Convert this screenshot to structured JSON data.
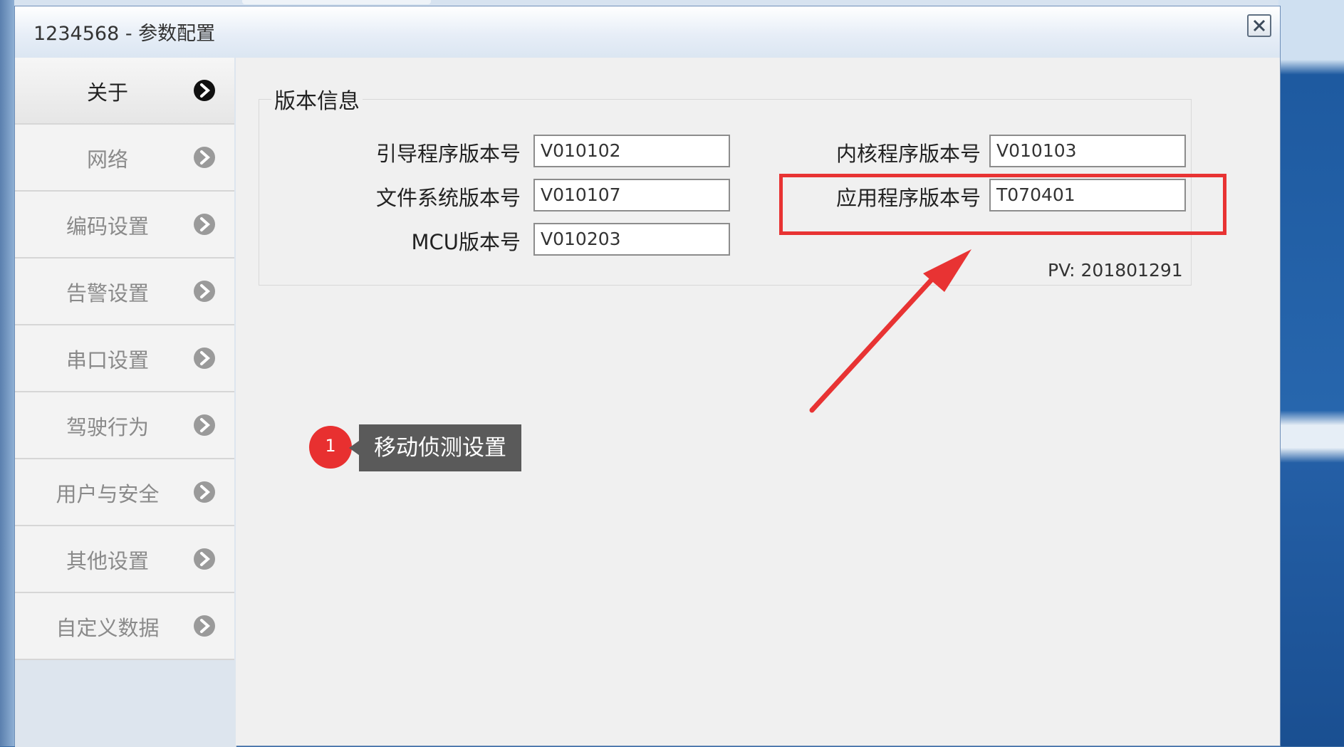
{
  "window": {
    "title": "1234568 - 参数配置"
  },
  "sidebar": {
    "items": [
      {
        "label": "关于",
        "active": true
      },
      {
        "label": "网络",
        "active": false
      },
      {
        "label": "编码设置",
        "active": false
      },
      {
        "label": "告警设置",
        "active": false
      },
      {
        "label": "串口设置",
        "active": false
      },
      {
        "label": "驾驶行为",
        "active": false
      },
      {
        "label": "用户与安全",
        "active": false
      },
      {
        "label": "其他设置",
        "active": false
      },
      {
        "label": "自定义数据",
        "active": false
      }
    ]
  },
  "version_info": {
    "group_title": "版本信息",
    "boot_label": "引导程序版本号",
    "boot_value": "V010102",
    "kernel_label": "内核程序版本号",
    "kernel_value": "V010103",
    "fs_label": "文件系统版本号",
    "fs_value": "V010107",
    "app_label": "应用程序版本号",
    "app_value": "T070401",
    "mcu_label": "MCU版本号",
    "mcu_value": "V010203",
    "pv_text": "PV: 201801291"
  },
  "annotation": {
    "badge_number": "1",
    "tooltip_text": "移动侦测设置",
    "highlight_color": "#e83333"
  },
  "colors": {
    "accent_red": "#e83030",
    "tooltip_bg": "#5a5a5a"
  }
}
